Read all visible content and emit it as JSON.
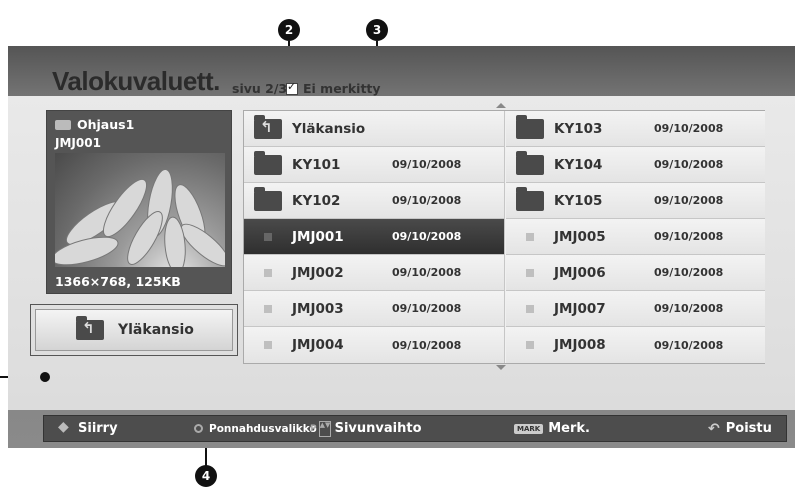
{
  "callouts": [
    "2",
    "3",
    "4"
  ],
  "screen": {
    "title": "Valokuvaluett.",
    "page_info": "sivu 2/3",
    "mark_status": "Ei merkitty",
    "preview": {
      "source": "Ohjaus1",
      "file_name": "JMJ001",
      "info": "1366×768, 125KB"
    },
    "up_button": "Yläkansio",
    "items": [
      {
        "name": "Yläkansio",
        "date": "",
        "type": "up"
      },
      {
        "name": "KY103",
        "date": "09/10/2008",
        "type": "folder"
      },
      {
        "name": "KY101",
        "date": "09/10/2008",
        "type": "folder"
      },
      {
        "name": "KY104",
        "date": "09/10/2008",
        "type": "folder"
      },
      {
        "name": "KY102",
        "date": "09/10/2008",
        "type": "folder"
      },
      {
        "name": "KY105",
        "date": "09/10/2008",
        "type": "folder"
      },
      {
        "name": "JMJ001",
        "date": "09/10/2008",
        "type": "file",
        "selected": true
      },
      {
        "name": "JMJ005",
        "date": "09/10/2008",
        "type": "file"
      },
      {
        "name": "JMJ002",
        "date": "09/10/2008",
        "type": "file"
      },
      {
        "name": "JMJ006",
        "date": "09/10/2008",
        "type": "file"
      },
      {
        "name": "JMJ003",
        "date": "09/10/2008",
        "type": "file"
      },
      {
        "name": "JMJ007",
        "date": "09/10/2008",
        "type": "file"
      },
      {
        "name": "JMJ004",
        "date": "09/10/2008",
        "type": "file"
      },
      {
        "name": "JMJ008",
        "date": "09/10/2008",
        "type": "file"
      }
    ],
    "footer": {
      "move": "Siirry",
      "popup_menu": "Ponnahdusvalikko",
      "page_change": "Sivunvaihto",
      "mark_key": "MARK",
      "mark": "Merk.",
      "exit": "Poistu"
    }
  }
}
